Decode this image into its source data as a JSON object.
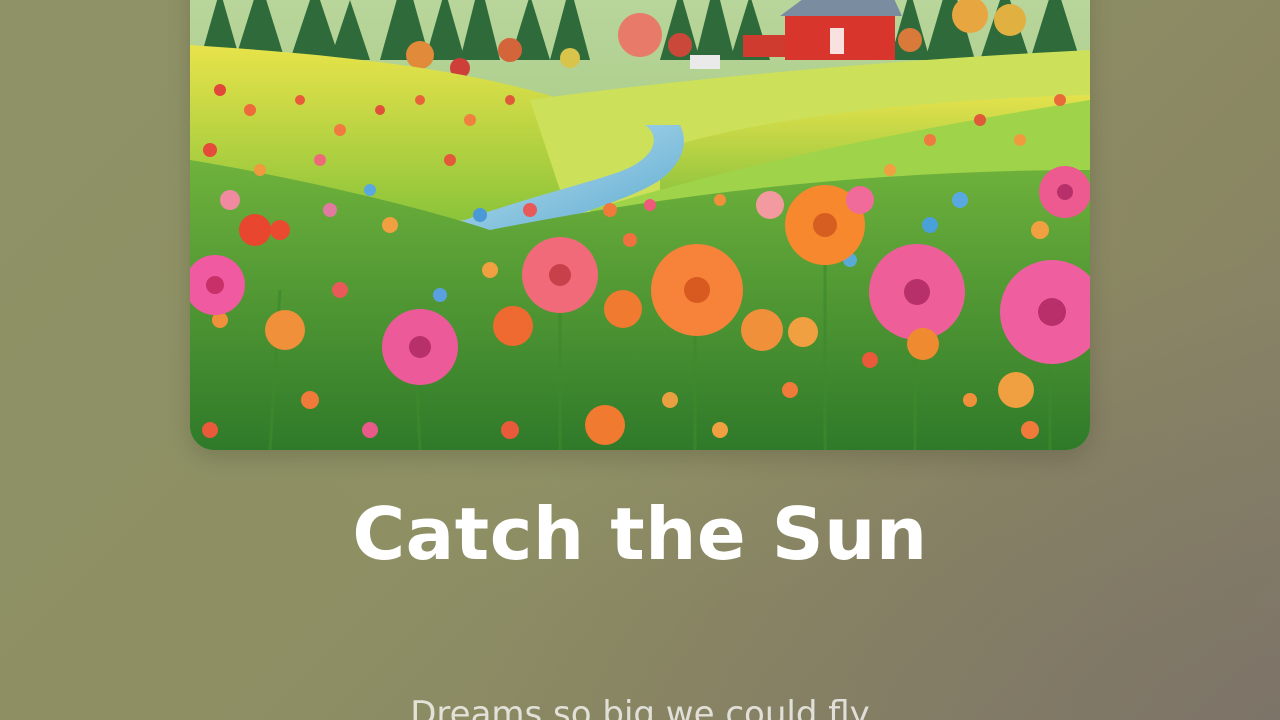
{
  "player": {
    "artwork_icon": "album-artwork-flower-meadow",
    "title": "Catch the Sun",
    "lyric_line": "Dreams so big we could fly"
  },
  "colors": {
    "background": "#8e9064",
    "title_text": "#ffffff",
    "lyric_text": "#e8e8dc"
  }
}
